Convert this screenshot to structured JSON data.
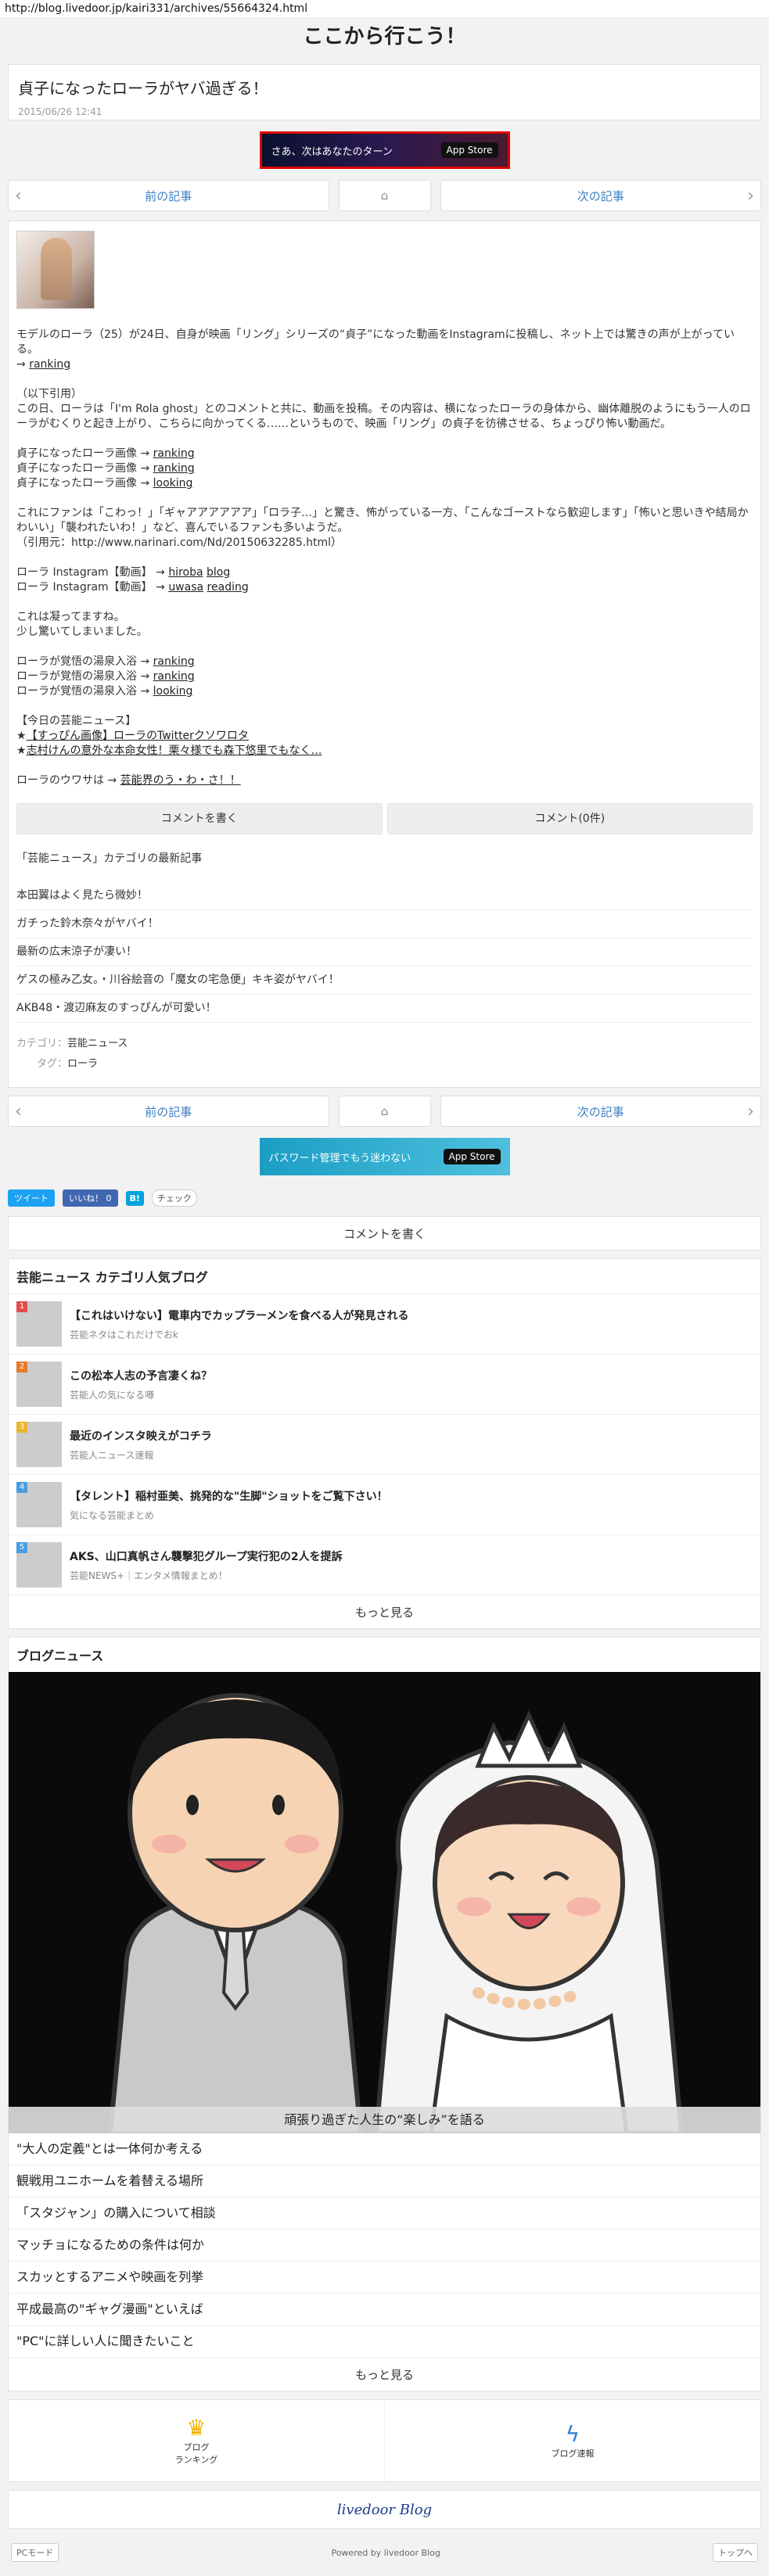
{
  "browser": {
    "url": "http://blog.livedoor.jp/kairi331/archives/55664324.html"
  },
  "site": {
    "title": "ここから行こう！"
  },
  "article": {
    "title": "貞子になったローラがヤバ過ぎる！",
    "date": "2015/06/26 12:41",
    "p1": "モデルのローラ（25）が24日、自身が映画「リング」シリーズの“貞子”になった動画をInstagramに投稿し、ネット上では驚きの声が上がっている。",
    "p1_link": "ranking",
    "quote_label": "（以下引用）",
    "quote": "この日、ローラは「I'm Rola ghost」とのコメントと共に、動画を投稿。その内容は、横になったローラの身体から、幽体離脱のようにもう一人のローラがむくりと起き上がり、こちらに向かってくる……というもので、映画「リング」の貞子を彷彿させる、ちょっぴり怖い動画だ。",
    "img_line": "貞子になったローラ画像 →",
    "img_links": [
      "ranking",
      "ranking",
      "looking"
    ],
    "fan_text": "これにファンは「こわっ！」「ギャアアアアアア」「ロラ子…」と驚き、怖がっている一方、「こんなゴーストなら歓迎します」「怖いと思いきや結局かわいい」「襲われたいわ！」など、喜んでいるファンも多いようだ。",
    "source": "（引用元：http://www.narinari.com/Nd/20150632285.html）",
    "insta_label": "ローラ Instagram【動画】 →",
    "insta1": [
      "hiroba",
      "blog"
    ],
    "insta2": [
      "uwasa",
      "reading"
    ],
    "comment1": "これは凝ってますね。",
    "comment2": "少し驚いてしまいました。",
    "bath_line": "ローラが覚悟の湯泉入浴 →",
    "bath_links": [
      "ranking",
      "ranking",
      "looking"
    ],
    "today_label": "【今日の芸能ニュース】",
    "today1": "【すっぴん画像】ローラのTwitterクソワロタ",
    "today2": "志村けんの意外な本命女性！栗々様でも森下悠里でもなく…",
    "rumor_label": "ローラのウワサは →",
    "rumor_link": "芸能界のう・わ・さ！！",
    "btn_write": "コメントを書く",
    "btn_comments": "コメント(0件)",
    "cat_title": "「芸能ニュース」カテゴリの最新記事",
    "cat_items": [
      "本田翼はよく見たら微妙！",
      "ガチった鈴木奈々がヤバイ！",
      "最新の広末涼子が凄い！",
      "ゲスの極み乙女。・川谷絵音の「魔女の宅急便」キキ姿がヤバイ！",
      "AKB48・渡辺麻友のすっぴんが可愛い！"
    ],
    "meta_cat_label": "カテゴリ：",
    "meta_cat": "芸能ニュース",
    "meta_tag_label": "タグ：",
    "meta_tag": "ローラ"
  },
  "nav": {
    "prev": "前の記事",
    "next": "次の記事"
  },
  "banner1": {
    "text": "さあ、次はあなたのターン",
    "store": " App Store"
  },
  "banner2": {
    "text": "パスワード管理でもう迷わない",
    "store": " App Store"
  },
  "social": {
    "tweet": "ツイート",
    "like": "いいね！ 0",
    "hatena": "B!",
    "check": "チェック"
  },
  "comment_write": "コメントを書く",
  "popular": {
    "title": "芸能ニュース カテゴリ人気ブログ",
    "items": [
      {
        "num": "1",
        "title": "【これはいけない】電車内でカップラーメンを食べる人が発見される",
        "sub": "芸能ネタはこれだけでおk",
        "color": "#e34c4c"
      },
      {
        "num": "2",
        "title": "この松本人志の予言凄くね？",
        "sub": "芸能人の気になる噂",
        "color": "#e87a2a"
      },
      {
        "num": "3",
        "title": "最近のインスタ映えがコチラ",
        "sub": "芸能人ニュース速報",
        "color": "#e8b62a"
      },
      {
        "num": "4",
        "title": "【タレント】稲村亜美、挑発的な\"生脚\"ショットをご覧下さい！",
        "sub": "気になる芸能まとめ",
        "color": "#4a9de0"
      },
      {
        "num": "5",
        "title": "AKS、山口真帆さん襲撃犯グループ実行犯の2人を提訴",
        "sub": "芸能NEWS+｜エンタメ情報まとめ！",
        "color": "#4a9de0"
      }
    ],
    "more": "もっと見る"
  },
  "blognews": {
    "title": "ブログニュース",
    "caption": "頑張り過ぎた人生の“楽しみ”を語る",
    "items": [
      "\"大人の定義\"とは一体何か考える",
      "観戦用ユニホームを着替える場所",
      "「スタジャン」の購入について相談",
      "マッチョになるための条件は何か",
      "スカッとするアニメや映画を列挙",
      "平成最高の\"ギャグ漫画\"といえば",
      "\"PC\"に詳しい人に聞きたいこと"
    ],
    "more": "もっと見る"
  },
  "footer": {
    "ranking_label": "ブログ\nランキング",
    "ranking_l1": "ブログ",
    "ranking_l2": "ランキング",
    "news_label": "ブログ速報",
    "logo": "livedoor Blog",
    "pc": "PCモード",
    "powered": "Powered by livedoor Blog",
    "top": "トップへ"
  }
}
